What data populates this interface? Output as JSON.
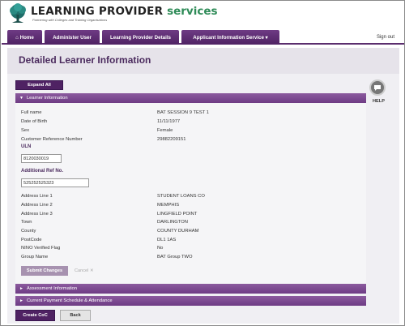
{
  "header": {
    "brand_main": "LEARNING PROVIDER ",
    "brand_accent": "services",
    "tagline": "Partnering with Colleges and Training Organisations"
  },
  "nav": {
    "home": "⌂ Home",
    "administer_user": "Administer User",
    "provider_details": "Learning Provider Details",
    "applicant_service": "Applicant Information Service ▾",
    "signout": "Sign out"
  },
  "page": {
    "title": "Detailed Learner Information"
  },
  "actions": {
    "expand_all": "Expand All",
    "help": "HELP"
  },
  "sections": {
    "learner_information": "Learner Information",
    "assessment_information": "Assessment Information",
    "payment_schedule": "Current Payment Schedule & Attendance"
  },
  "learner": {
    "rows_top": [
      {
        "label": "Full name",
        "value": "BAT SESSION 9 TEST 1"
      },
      {
        "label": "Date of Birth",
        "value": "11/11/1977"
      },
      {
        "label": "Sex",
        "value": "Female"
      },
      {
        "label": "Customer Reference Number",
        "value": "29882209151"
      }
    ],
    "uln_label": "ULN",
    "uln_value": "8120030019",
    "additional_ref_label": "Additional Ref No.",
    "additional_ref_value": "525252525323",
    "rows_bottom": [
      {
        "label": "Address Line 1",
        "value": "STUDENT LOANS CO"
      },
      {
        "label": "Address Line 2",
        "value": "MEMPHIS"
      },
      {
        "label": "Address Line 3",
        "value": "LINGFIELD POINT"
      },
      {
        "label": "Town",
        "value": "DARLINGTON"
      },
      {
        "label": "County",
        "value": "COUNTY DURHAM"
      },
      {
        "label": "PostCode",
        "value": "DL1 1AS"
      },
      {
        "label": "NINO Verified Flag",
        "value": "No"
      },
      {
        "label": "Group Name",
        "value": "BAT Group TWO"
      }
    ],
    "submit_changes": "Submit Changes",
    "cancel": "Cancel ✕"
  },
  "footer_buttons": {
    "create_coc": "Create CoC",
    "back": "Back"
  },
  "colors": {
    "brand_purple": "#4f2263",
    "section_purple": "#7a4a90",
    "brand_green": "#2e8b57"
  }
}
